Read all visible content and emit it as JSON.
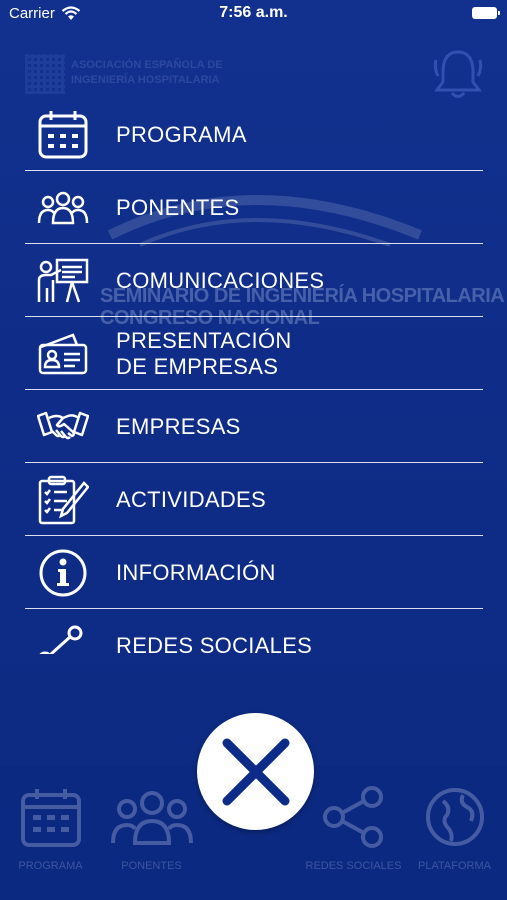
{
  "status_bar": {
    "carrier": "Carrier",
    "time": "7:56 a.m."
  },
  "background": {
    "logo1_text_line1": "ASOCIACIÓN ESPAÑOLA DE",
    "logo1_text_line2": "INGENIERÍA HOSPITALARIA",
    "banner_line1": "SEMINARIO DE INGENIERÍA HOSPITALARIA",
    "banner_line2": "CONGRESO NACIONAL",
    "tabs": [
      {
        "label": "PROGRAMA",
        "icon": "calendar-icon"
      },
      {
        "label": "PONENTES",
        "icon": "people-icon"
      },
      {
        "label": "",
        "icon": ""
      },
      {
        "label": "REDES SOCIALES",
        "icon": "share-icon"
      },
      {
        "label": "PLATAFORMA",
        "icon": "globe-icon"
      }
    ]
  },
  "menu": {
    "items": [
      {
        "label": "PROGRAMA",
        "icon": "calendar-icon"
      },
      {
        "label": "PONENTES",
        "icon": "people-icon"
      },
      {
        "label": "COMUNICACIONES",
        "icon": "presenter-icon"
      },
      {
        "label": "PRESENTACIÓN\nDE EMPRESAS",
        "icon": "business-card-icon"
      },
      {
        "label": "EMPRESAS",
        "icon": "handshake-icon"
      },
      {
        "label": "ACTIVIDADES",
        "icon": "checklist-icon"
      },
      {
        "label": "INFORMACIÓN",
        "icon": "info-icon"
      },
      {
        "label": "REDES SOCIALES",
        "icon": "share-icon"
      }
    ]
  },
  "close_button": {
    "icon": "close-icon"
  },
  "colors": {
    "background": "#0d2c8a",
    "foreground": "#ffffff",
    "close_x": "#0d2c8a"
  }
}
